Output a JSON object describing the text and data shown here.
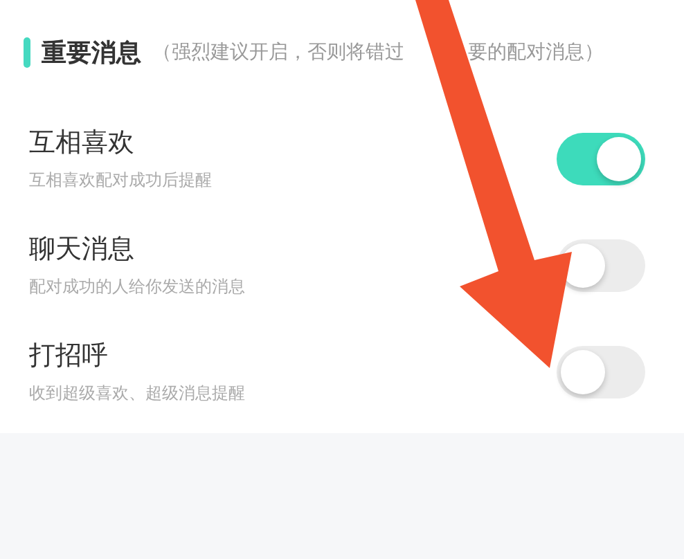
{
  "section": {
    "title": "重要消息",
    "note_before": "（强烈建议开启，否则将错过",
    "note_after": "要的配对消息）"
  },
  "settings": [
    {
      "title": "互相喜欢",
      "subtitle": "互相喜欢配对成功后提醒",
      "on": true
    },
    {
      "title": "聊天消息",
      "subtitle": "配对成功的人给你发送的消息",
      "on": false
    },
    {
      "title": "打招呼",
      "subtitle": "收到超级喜欢、超级消息提醒",
      "on": false
    }
  ]
}
